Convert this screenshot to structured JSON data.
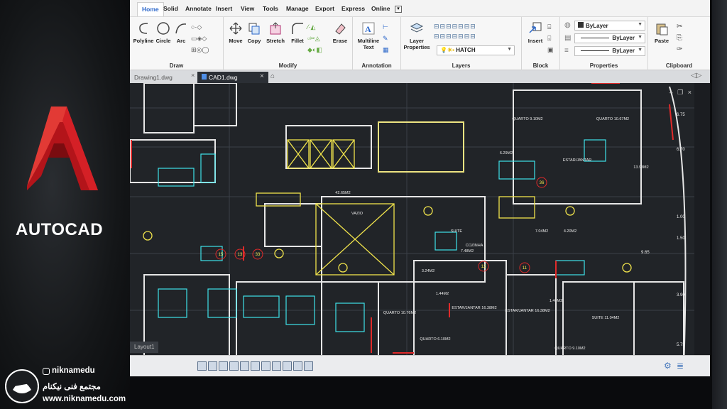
{
  "brand": {
    "title": "AUTOCAD",
    "instagram": "niknamedu",
    "center_name": "مجتمع فنی نیکنام",
    "website": "www.niknamedu.com",
    "logo_color": "#c7161c"
  },
  "ribbon": {
    "tabs": [
      "Home",
      "Solid",
      "Annotate",
      "Insert",
      "View",
      "Tools",
      "Manage",
      "Export",
      "Express",
      "Online"
    ],
    "active_tab": "Home",
    "groups": {
      "draw": {
        "title": "Draw",
        "buttons": [
          "Polyline",
          "Circle",
          "Arc"
        ]
      },
      "modify": {
        "title": "Modify",
        "buttons": [
          "Move",
          "Copy",
          "Stretch",
          "Fillet",
          "Erase"
        ]
      },
      "annotation": {
        "title": "Annotation",
        "buttons": [
          "Multiline Text"
        ]
      },
      "layers": {
        "title": "Layers",
        "buttons": [
          "Layer Properties"
        ],
        "current_layer": "HATCH"
      },
      "block": {
        "title": "Block",
        "buttons": [
          "Insert"
        ]
      },
      "properties": {
        "title": "Properties",
        "color": "ByLayer",
        "linetype": "ByLayer",
        "lineweight": "ByLayer"
      },
      "clipboard": {
        "title": "Clipboard",
        "buttons": [
          "Paste"
        ]
      }
    }
  },
  "file_tabs": [
    "Drawing1.dwg",
    "CAD1.dwg"
  ],
  "active_file": "CAD1.dwg",
  "layout_tab": "Layout1",
  "drawing": {
    "room_labels": [
      "42.65M2",
      "VAZIO",
      "QUARTO 9.10M2",
      "QUARTO 10.67M2",
      "6.29M2",
      "ESTAR/JANTAR",
      "13.93M2",
      "7.04M2",
      "4.20M2",
      "COZINHA",
      "SUITE",
      "7.48M2",
      "3.24M2",
      "1.44M2",
      "QUARTO 10.76M2",
      "ESTAR/JANTAR 16.38M2",
      "ESTAR/JANTAR 16.38M2",
      "1.44M2",
      "SUITE 11.04M2",
      "QUARTO 6.10M2",
      "QUARTO 9.10M2"
    ],
    "dimension_labels": [
      "6.75",
      "6.70",
      "1.00",
      "1.50",
      "9.65",
      "3.90",
      "5.75"
    ],
    "grid_bubbles": [
      "36",
      "33",
      "15",
      "13",
      "12",
      "11"
    ]
  },
  "colors": {
    "cyan": "#3fe3ea",
    "yellow": "#f1e44c",
    "red": "#e12a2a",
    "white": "#e6e6e6",
    "canvas": "#212428"
  }
}
